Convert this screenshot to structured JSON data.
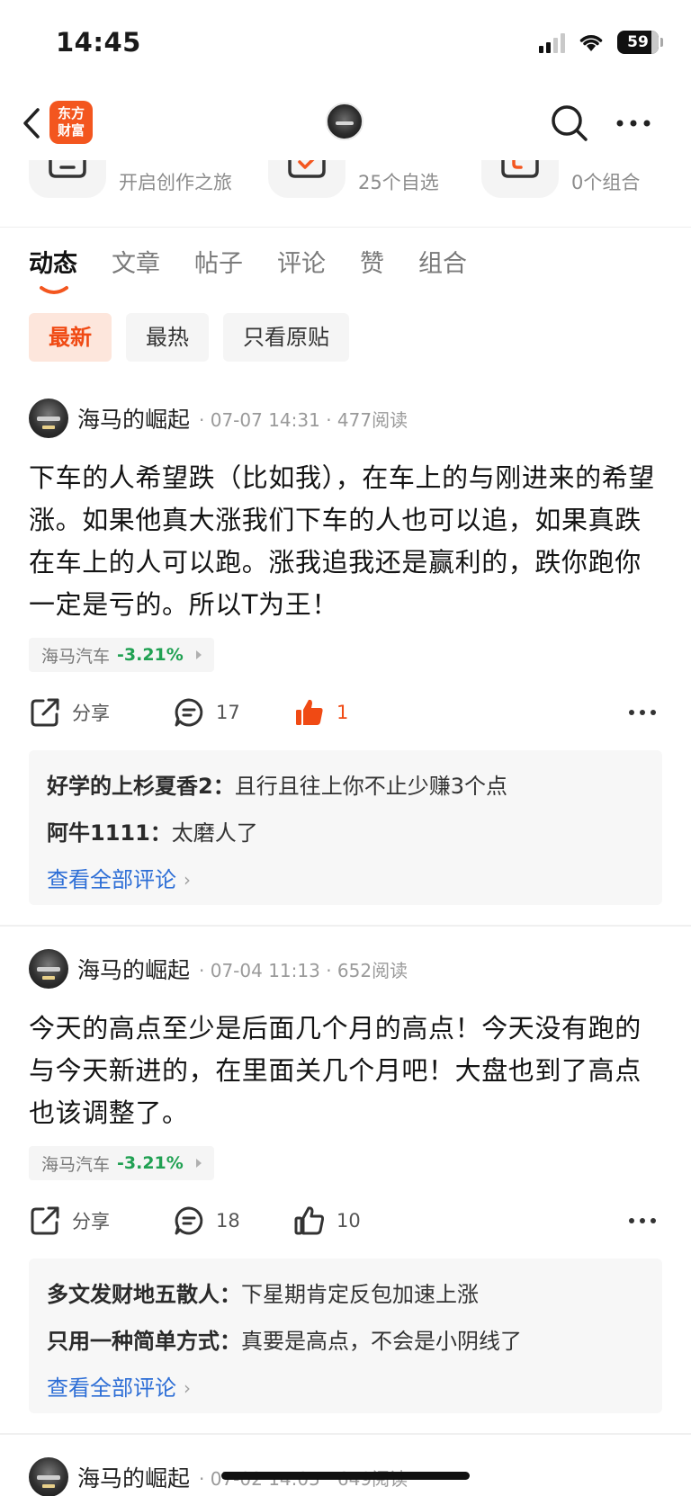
{
  "status_bar": {
    "time": "14:45",
    "battery": "59"
  },
  "nav": {
    "brand_logo_text": "东方\n财富",
    "icons": [
      "back-icon",
      "search-icon",
      "more-icon"
    ]
  },
  "quick_row": [
    {
      "icon": "pencil-icon",
      "label": "开启创作之旅"
    },
    {
      "icon": "checkmark-icon",
      "label": "25个自选"
    },
    {
      "icon": "portfolio-icon",
      "label": "0个组合"
    }
  ],
  "tabs": [
    "动态",
    "文章",
    "帖子",
    "评论",
    "赞",
    "组合"
  ],
  "active_tab": "动态",
  "filters": [
    "最新",
    "最热",
    "只看原贴"
  ],
  "active_filter": "最新",
  "posts": [
    {
      "author": "海马的崛起",
      "meta": "· 07-07 14:31 · 477阅读",
      "body": "下车的人希望跌（比如我），在车上的与刚进来的希望涨。如果他真大涨我们下车的人也可以追，如果真跌在车上的人可以跑。涨我追我还是赢利的，跌你跑你一定是亏的。所以T为王！",
      "stock": {
        "name": "海马汽车",
        "change": "-3.21%"
      },
      "share_label": "分享",
      "comment_count": "17",
      "like_count": "1",
      "liked": true,
      "comments": [
        {
          "user": "好学的上杉夏香2",
          "sep": "：",
          "text": "且行且往上你不止少赚3个点"
        },
        {
          "user": "阿牛1111",
          "sep": "：",
          "text": "太磨人了"
        }
      ],
      "view_all": "查看全部评论"
    },
    {
      "author": "海马的崛起",
      "meta": "· 07-04 11:13 · 652阅读",
      "body": "今天的高点至少是后面几个月的高点！今天没有跑的与今天新进的，在里面关几个月吧！大盘也到了高点也该调整了。",
      "stock": {
        "name": "海马汽车",
        "change": "-3.21%"
      },
      "share_label": "分享",
      "comment_count": "18",
      "like_count": "10",
      "liked": false,
      "comments": [
        {
          "user": "多文发财地五散人",
          "sep": "：",
          "text": "下星期肯定反包加速上涨"
        },
        {
          "user": "只用一种简单方式",
          "sep": "：",
          "text": "真要是高点，不会是小阴线了"
        }
      ],
      "view_all": "查看全部评论"
    },
    {
      "author": "海马的崛起",
      "meta": "· 07-02 14:05 · 649阅读"
    }
  ]
}
